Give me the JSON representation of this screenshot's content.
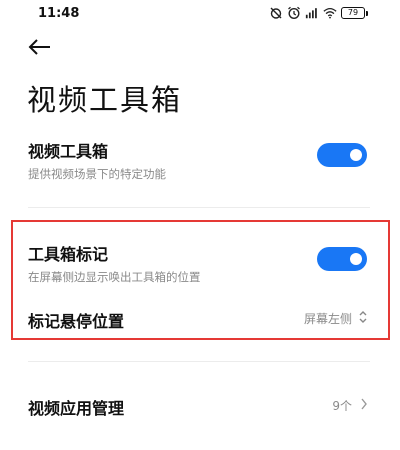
{
  "status_bar": {
    "time": "11:48",
    "icons": [
      "alarm-off-icon",
      "alarm-icon",
      "signal-icon",
      "wifi-icon"
    ],
    "battery": "79"
  },
  "header": {
    "back_icon": "back-arrow-icon",
    "title": "视频工具箱"
  },
  "settings": {
    "video_toolbox": {
      "title": "视频工具箱",
      "subtitle": "提供视频场景下的特定功能",
      "enabled": true
    },
    "toolbox_marker": {
      "title": "工具箱标记",
      "subtitle": "在屏幕侧边显示唤出工具箱的位置",
      "enabled": true
    },
    "marker_position": {
      "title": "标记悬停位置",
      "value": "屏幕左侧"
    },
    "video_app_management": {
      "title": "视频应用管理",
      "value": "9个"
    }
  },
  "colors": {
    "accent": "#1977f5",
    "highlight": "#e53935"
  }
}
